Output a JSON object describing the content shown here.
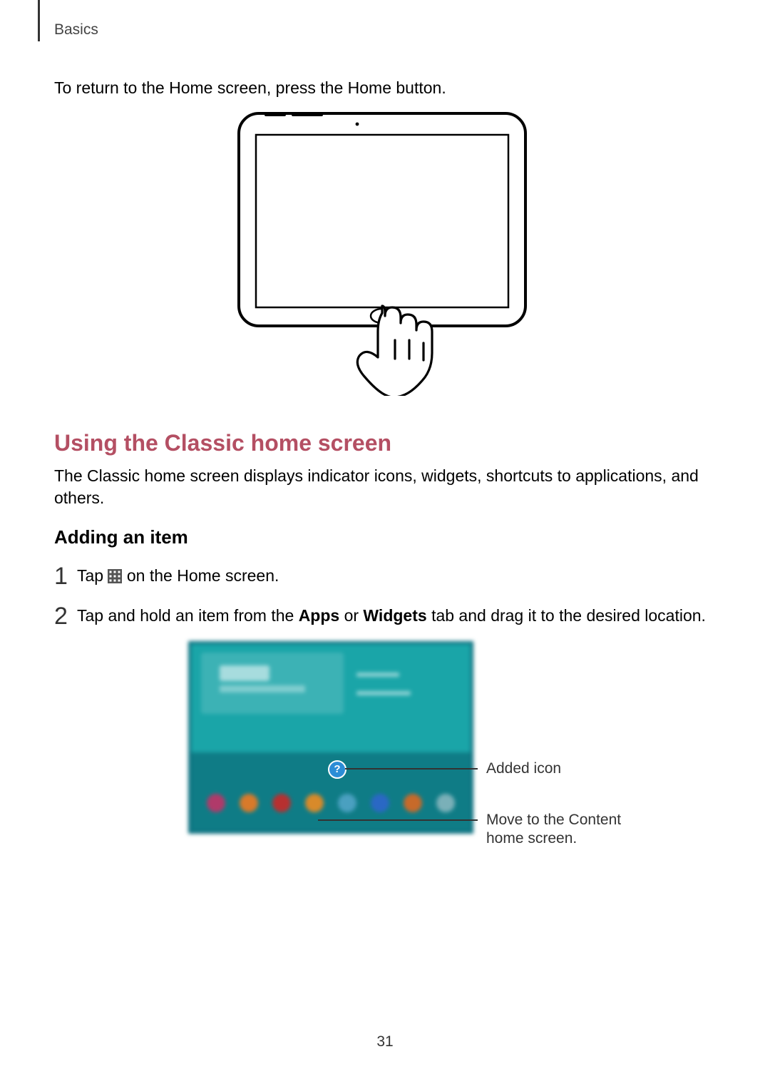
{
  "section_label": "Basics",
  "intro_para": "To return to the Home screen, press the Home button.",
  "h2": "Using the Classic home screen",
  "desc": "The Classic home screen displays indicator icons, widgets, shortcuts to applications, and others.",
  "h3": "Adding an item",
  "steps": {
    "s1_num": "1",
    "s1_pre": "Tap ",
    "s1_post": " on the Home screen.",
    "s2_num": "2",
    "s2_pre": "Tap and hold an item from the ",
    "s2_b1": "Apps",
    "s2_mid": " or ",
    "s2_b2": "Widgets",
    "s2_post": " tab and drag it to the desired location."
  },
  "callouts": {
    "added_icon": "Added icon",
    "move_content_l1": "Move to the Content",
    "move_content_l2": "home screen."
  },
  "page_number": "31"
}
